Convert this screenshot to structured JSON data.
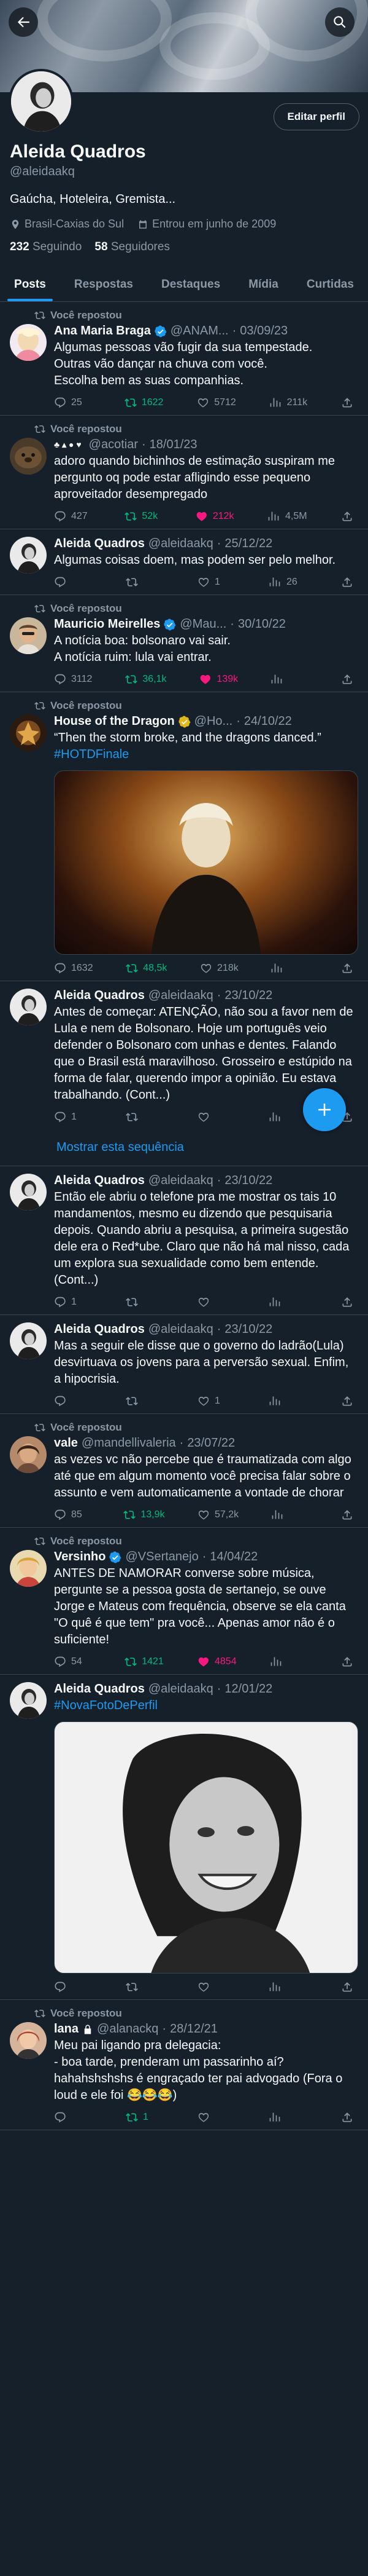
{
  "header": {
    "back_icon": "back-arrow-icon",
    "search_icon": "search-icon"
  },
  "profile": {
    "name": "Aleida Quadros",
    "handle": "@aleidaakq",
    "bio": "Gaúcha, Hoteleira, Gremista...",
    "location": "Brasil-Caxias do Sul",
    "joined": "Entrou em junho de 2009",
    "following_count": "232",
    "following_label": "Seguindo",
    "followers_count": "58",
    "followers_label": "Seguidores",
    "edit_label": "Editar perfil"
  },
  "tabs": [
    "Posts",
    "Respostas",
    "Destaques",
    "Mídia",
    "Curtidas"
  ],
  "repost_label": "Você repostou",
  "show_thread": "Mostrar esta sequência",
  "tweets": [
    {
      "name": "Ana Maria Braga",
      "verified": true,
      "handle": "@ANAM...",
      "date": "03/09/23",
      "text": "Algumas pessoas vão fugir da sua tempestade.\nOutras vão dançar na chuva com você.\nEscolha bem as suas companhias.",
      "replies": "25",
      "retweets": "1622",
      "likes": "5712",
      "views": "211k"
    },
    {
      "name": "",
      "handle": "@acotiar",
      "date": "18/01/23",
      "text": "adoro quando bichinhos de estimação suspiram me pergunto oq pode estar afligindo esse pequeno aproveitador desempregado",
      "replies": "427",
      "retweets": "52k",
      "likes": "212k",
      "views": "4,5M"
    },
    {
      "name": "Aleida Quadros",
      "handle": "@aleidaakq",
      "date": "25/12/22",
      "text": "Algumas coisas doem, mas podem ser pelo melhor.",
      "replies": "",
      "retweets": "",
      "likes": "1",
      "views": "26"
    },
    {
      "name": "Mauricio Meirelles",
      "verified": true,
      "handle": "@Mau...",
      "date": "30/10/22",
      "text": "A notícia boa: bolsonaro vai sair.\nA notícia ruim: lula vai entrar.",
      "replies": "3112",
      "retweets": "36,1k",
      "likes": "139k",
      "views": ""
    },
    {
      "name": "House of the Dragon",
      "verified": true,
      "handle": "@Ho...",
      "date": "24/10/22",
      "text": "“Then the storm broke, and the dragons danced.” ",
      "hashtag": "#HOTDFinale",
      "replies": "1632",
      "retweets": "48,5k",
      "likes": "218k",
      "views": ""
    },
    {
      "name": "Aleida Quadros",
      "handle": "@aleidaakq",
      "date": "23/10/22",
      "text": "Antes de começar: ATENÇÃO, não sou a favor nem de Lula e nem de Bolsonaro. Hoje um português veio defender o Bolsonaro com unhas e dentes. Falando que o Brasil está maravilhoso. Grosseiro e estúpido na forma de falar, querendo impor a opinião. Eu estava trabalhando.  (Cont...)",
      "replies": "1",
      "retweets": "",
      "likes": "",
      "views": ""
    },
    {
      "name": "Aleida Quadros",
      "handle": "@aleidaakq",
      "date": "23/10/22",
      "text": "Então ele abriu o telefone pra me mostrar os tais 10 mandamentos, mesmo eu dizendo que pesquisaria depois. Quando abriu a pesquisa, a primeira sugestão dele era o Red*ube. Claro que não há mal nisso, cada um explora sua sexualidade como bem entende. (Cont...)",
      "replies": "1",
      "retweets": "",
      "likes": "",
      "views": ""
    },
    {
      "name": "Aleida Quadros",
      "handle": "@aleidaakq",
      "date": "23/10/22",
      "text": "Mas a seguir ele disse que o governo do ladrão(Lula) desvirtuava os jovens para a perversão sexual. Enfim, a hipocrisia.",
      "replies": "",
      "retweets": "",
      "likes": "1",
      "views": ""
    },
    {
      "name": "vale",
      "handle": "@mandellivaleria",
      "date": "23/07/22",
      "text": "as vezes vc não percebe que é traumatizada com algo até que em algum momento você precisa falar sobre o assunto e vem automaticamente a vontade de chorar",
      "replies": "85",
      "retweets": "13,9k",
      "likes": "57,2k",
      "views": ""
    },
    {
      "name": "Versinho",
      "verified": true,
      "handle": "@VSertanejo",
      "date": "14/04/22",
      "text": "ANTES DE NAMORAR converse sobre música, pergunte se a pessoa gosta de sertanejo, se ouve Jorge e Mateus com frequência, observe se ela canta \"O quê é que tem\" pra você... Apenas amor não é o suficiente!",
      "replies": "54",
      "retweets": "1421",
      "likes": "4854",
      "views": ""
    },
    {
      "name": "Aleida Quadros",
      "handle": "@aleidaakq",
      "date": "12/01/22",
      "text": "",
      "hashtag": "#NovaFotoDePerfil",
      "replies": "",
      "retweets": "",
      "likes": "",
      "views": ""
    },
    {
      "name": "lana",
      "handle": "@alanackq",
      "date": "28/12/21",
      "text": "Meu pai ligando pra delegacia:\n- boa tarde, prenderam um passarinho aí?\nhahahshshshs é engraçado ter pai advogado (Fora o loud e ele foi 😂😂😂)",
      "replies": "",
      "retweets": "1",
      "likes": "",
      "views": ""
    }
  ],
  "colors": {
    "bg": "#15202b",
    "accent": "#1d9bf0",
    "retweet": "#00ba7c",
    "like": "#f91880",
    "muted": "#8b98a5"
  }
}
